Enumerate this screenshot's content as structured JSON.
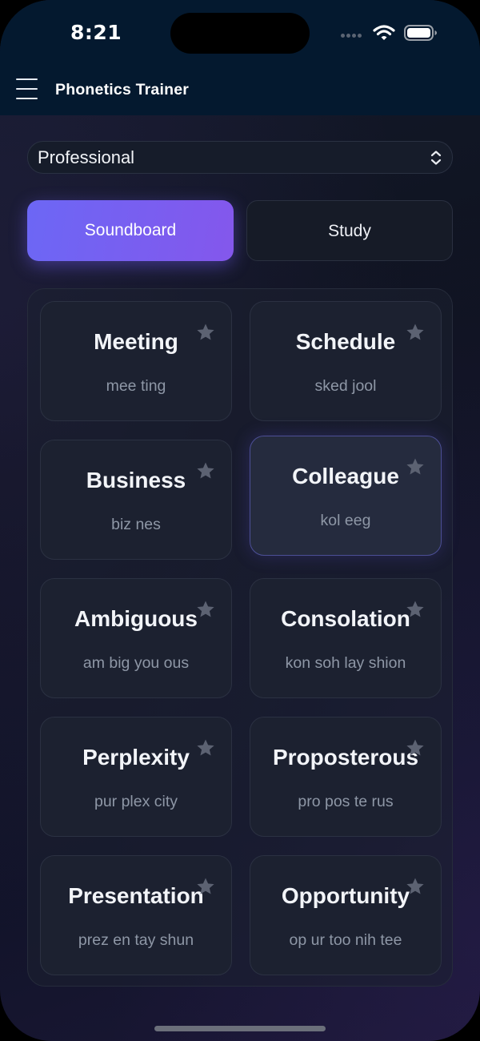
{
  "status": {
    "time": "8:21"
  },
  "header": {
    "title": "Phonetics Trainer"
  },
  "category_select": {
    "value": "Professional"
  },
  "tabs": [
    {
      "label": "Soundboard",
      "active": true
    },
    {
      "label": "Study",
      "active": false
    }
  ],
  "words": [
    {
      "word": "Meeting",
      "phonetic": "mee ting"
    },
    {
      "word": "Schedule",
      "phonetic": "sked jool"
    },
    {
      "word": "Business",
      "phonetic": "biz nes"
    },
    {
      "word": "Colleague",
      "phonetic": "kol eeg"
    },
    {
      "word": "Ambiguous",
      "phonetic": "am big you ous"
    },
    {
      "word": "Consolation",
      "phonetic": "kon soh lay shion"
    },
    {
      "word": "Perplexity",
      "phonetic": "pur plex city"
    },
    {
      "word": "Proposterous",
      "phonetic": "pro pos te rus"
    },
    {
      "word": "Presentation",
      "phonetic": "prez en tay shun"
    },
    {
      "word": "Opportunity",
      "phonetic": "op ur too nih tee"
    }
  ],
  "colors": {
    "accent_start": "#6c67f5",
    "accent_end": "#8457ec",
    "header_bg": "#04192f"
  },
  "icons": {
    "menu": "hamburger-menu-icon",
    "favorite": "star-icon",
    "select": "chevron-updown-icon"
  }
}
